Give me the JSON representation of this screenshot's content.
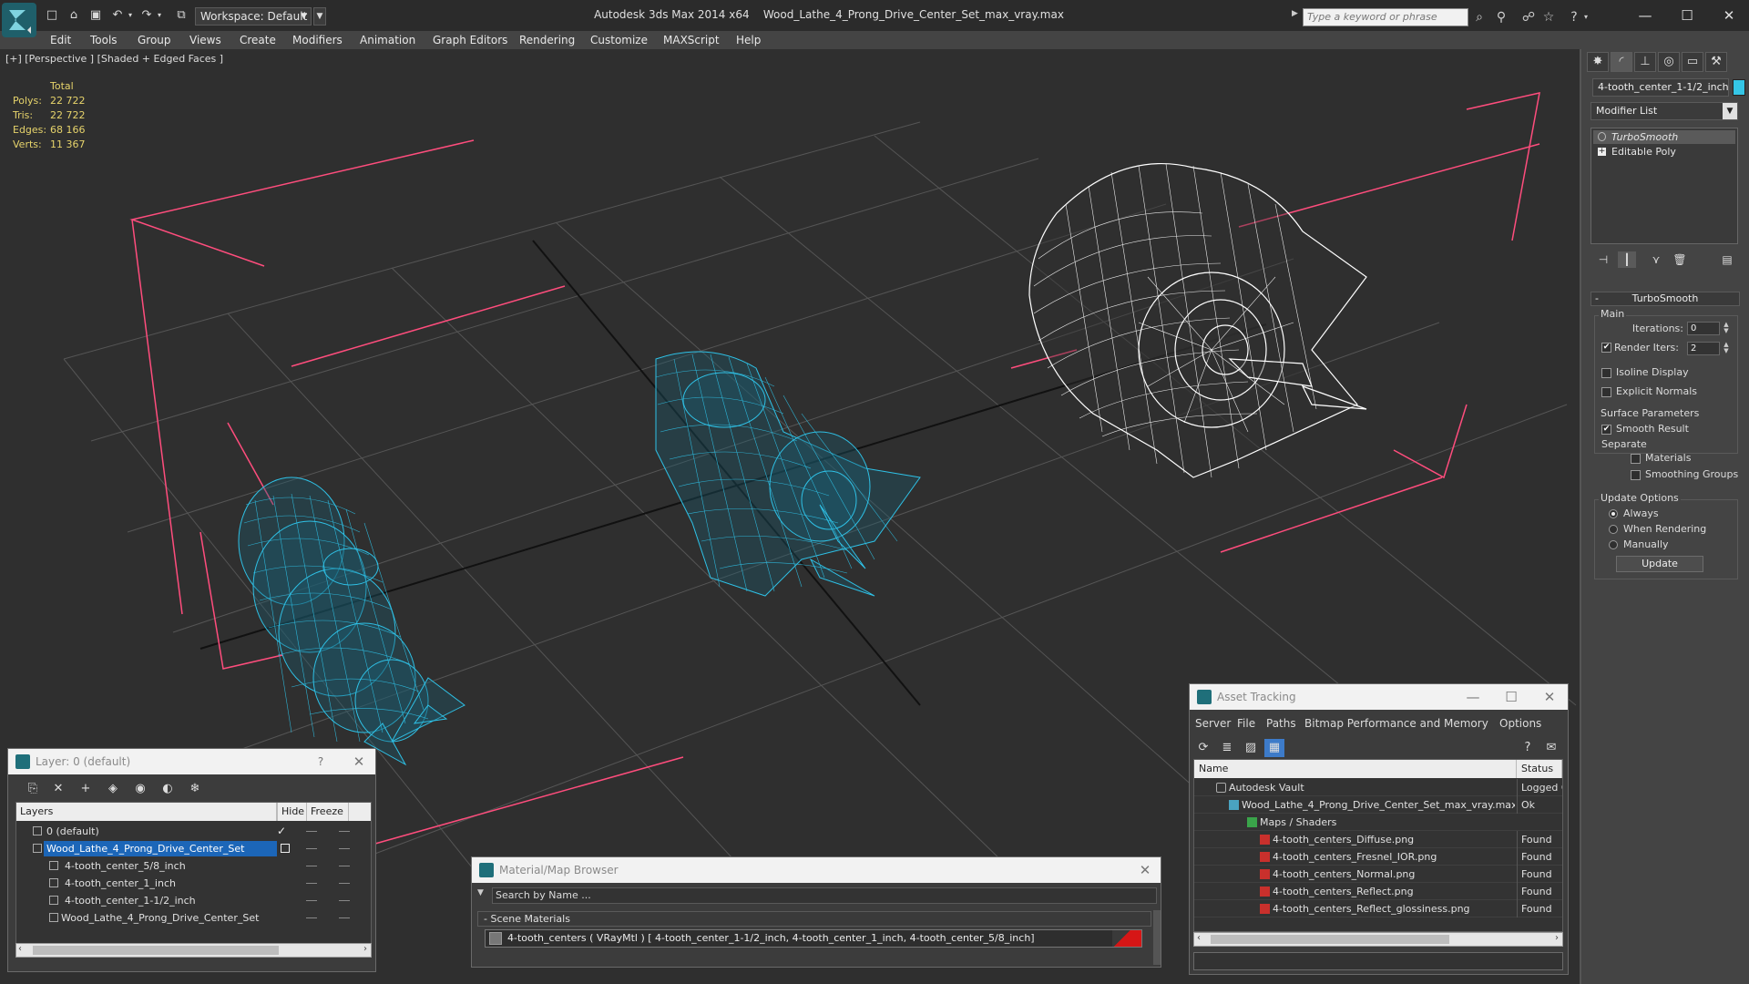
{
  "titlebar": {
    "workspace": "Workspace: Default",
    "app_title": "Autodesk 3ds Max  2014 x64",
    "file_title": "Wood_Lathe_4_Prong_Drive_Center_Set_max_vray.max",
    "search_placeholder": "Type a keyword or phrase"
  },
  "menu": [
    "Edit",
    "Tools",
    "Group",
    "Views",
    "Create",
    "Modifiers",
    "Animation",
    "Graph Editors",
    "Rendering",
    "Customize",
    "MAXScript",
    "Help"
  ],
  "viewport": {
    "label": "[+] [Perspective ] [Shaded + Edged Faces ]",
    "stats_header": "Total",
    "stats": [
      {
        "label": "Polys:",
        "value": "22 722"
      },
      {
        "label": "Tris:",
        "value": "22 722"
      },
      {
        "label": "Edges:",
        "value": "68 166"
      },
      {
        "label": "Verts:",
        "value": "11 367"
      }
    ],
    "colors": {
      "wire_selected": "#2fc1e6",
      "wire_white": "#ffffff",
      "bbox": "#ff4d7d",
      "grid": "#5a5a5a",
      "bg": "#2f2f2f"
    }
  },
  "command_panel": {
    "object_name": "4-tooth_center_1-1/2_inch",
    "object_color": "#35c6e6",
    "modifier_list": "Modifier List",
    "stack": [
      "TurboSmooth",
      "Editable Poly"
    ],
    "rollout_title": "TurboSmooth",
    "main_label": "Main",
    "iterations_label": "Iterations:",
    "iterations_value": "0",
    "render_iters_label": "Render Iters:",
    "render_iters_value": "2",
    "isoline_label": "Isoline Display",
    "explicit_normals_label": "Explicit Normals",
    "surface_params_label": "Surface Parameters",
    "smooth_result_label": "Smooth Result",
    "separate_label": "Separate",
    "materials_label": "Materials",
    "smoothing_groups_label": "Smoothing Groups",
    "update_options_label": "Update Options",
    "always_label": "Always",
    "when_rendering_label": "When Rendering",
    "manually_label": "Manually",
    "update_button": "Update"
  },
  "layer_dialog": {
    "title": "Layer: 0 (default)",
    "help": "?",
    "columns": [
      "Layers",
      "Hide",
      "Freeze"
    ],
    "rows": [
      {
        "name": "0 (default)",
        "selected": false
      },
      {
        "name": "Wood_Lathe_4_Prong_Drive_Center_Set",
        "selected": true
      },
      {
        "name": "4-tooth_center_5/8_inch",
        "selected": false
      },
      {
        "name": "4-tooth_center_1_inch",
        "selected": false
      },
      {
        "name": "4-tooth_center_1-1/2_inch",
        "selected": false
      },
      {
        "name": "Wood_Lathe_4_Prong_Drive_Center_Set",
        "selected": false
      }
    ]
  },
  "material_browser": {
    "title": "Material/Map Browser",
    "search_placeholder": "Search by Name ...",
    "section": "Scene Materials",
    "material_row": "4-tooth_centers  ( VRayMtl )  [ 4-tooth_center_1-1/2_inch,  4-tooth_center_1_inch,  4-tooth_center_5/8_inch]"
  },
  "asset_tracking": {
    "title": "Asset Tracking",
    "menu": [
      "Server",
      "File",
      "Paths",
      "Bitmap Performance and Memory",
      "Options"
    ],
    "columns": [
      "Name",
      "Status"
    ],
    "rows": [
      {
        "name": "Autodesk Vault",
        "status": "Logged Ou"
      },
      {
        "name": "Wood_Lathe_4_Prong_Drive_Center_Set_max_vray.max",
        "status": "Ok"
      },
      {
        "name": "Maps / Shaders",
        "status": ""
      },
      {
        "name": "4-tooth_centers_Diffuse.png",
        "status": "Found"
      },
      {
        "name": "4-tooth_centers_Fresnel_IOR.png",
        "status": "Found"
      },
      {
        "name": "4-tooth_centers_Normal.png",
        "status": "Found"
      },
      {
        "name": "4-tooth_centers_Reflect.png",
        "status": "Found"
      },
      {
        "name": "4-tooth_centers_Reflect_glossiness.png",
        "status": "Found"
      }
    ]
  }
}
